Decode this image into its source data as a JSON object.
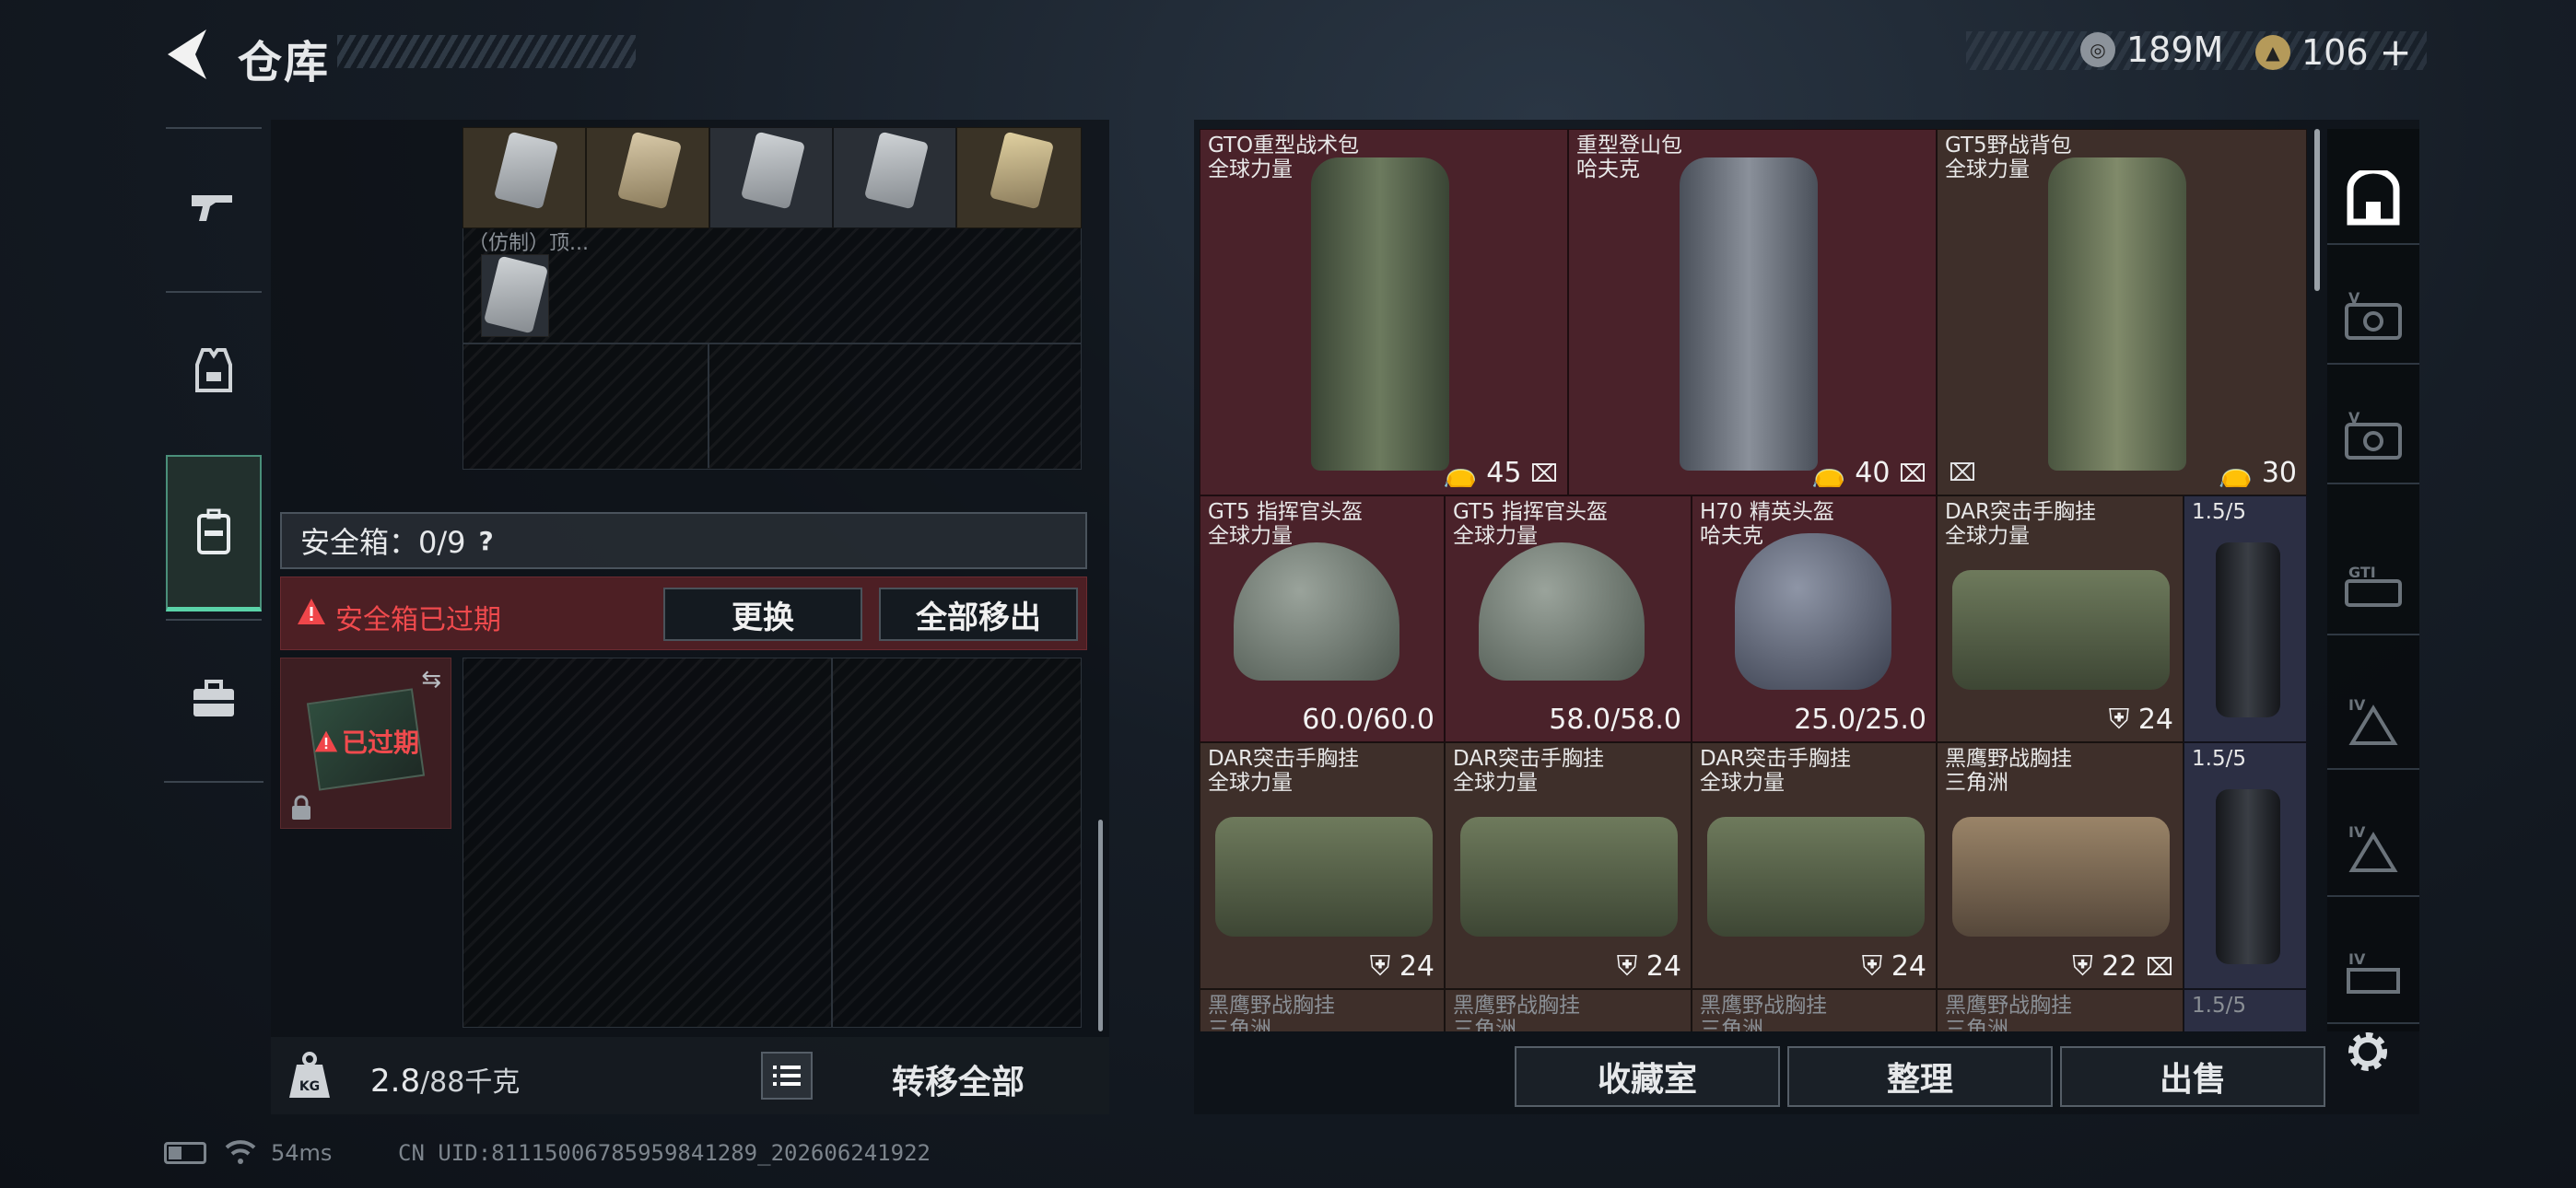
{
  "header": {
    "title": "仓库"
  },
  "currency": {
    "silver": "189M",
    "gold": "106"
  },
  "safebox": {
    "label": "安全箱：0/9",
    "help": "?",
    "expired_warning": "安全箱已过期",
    "replace": "更换",
    "move_all_out": "全部移出",
    "expired_tag": "已过期"
  },
  "grid_label": "（仿制）顶...",
  "weight": {
    "current": "2.8",
    "max": "/88千克"
  },
  "transfer_all": "转移全部",
  "items": [
    {
      "line1": "GTO重型战术包",
      "line2": "全球力量",
      "value": "45"
    },
    {
      "line1": "重型登山包",
      "line2": "哈夫克",
      "value": "40"
    },
    {
      "line1": "GT5野战背包",
      "line2": "全球力量",
      "value": "30"
    },
    {
      "line1": "GT5 指挥官头盔",
      "line2": "全球力量",
      "value": "60.0/60.0"
    },
    {
      "line1": "GT5 指挥官头盔",
      "line2": "全球力量",
      "value": "58.0/58.0"
    },
    {
      "line1": "H70 精英头盔",
      "line2": "哈夫克",
      "value": "25.0/25.0"
    },
    {
      "line1": "DAR突击手胸挂",
      "line2": "全球力量",
      "value": "24"
    },
    {
      "line1": "1.5/5",
      "line2": "",
      "value": ""
    },
    {
      "line1": "DAR突击手胸挂",
      "line2": "全球力量",
      "value": "24"
    },
    {
      "line1": "DAR突击手胸挂",
      "line2": "全球力量",
      "value": "24"
    },
    {
      "line1": "DAR突击手胸挂",
      "line2": "全球力量",
      "value": "24"
    },
    {
      "line1": "黑鹰野战胸挂",
      "line2": "三角洲",
      "value": "22"
    },
    {
      "line1": "1.5/5",
      "line2": "",
      "value": ""
    },
    {
      "line1": "黑鹰野战胸挂",
      "line2": "三角洲",
      "value": ""
    },
    {
      "line1": "黑鹰野战胸挂",
      "line2": "三角洲",
      "value": ""
    },
    {
      "line1": "黑鹰野战胸挂",
      "line2": "三角洲",
      "value": ""
    },
    {
      "line1": "黑鹰野战胸挂",
      "line2": "三角洲",
      "value": ""
    },
    {
      "line1": "1.5/5",
      "line2": "",
      "value": ""
    }
  ],
  "right_icon_labels": [
    "V",
    "V",
    "GTI",
    "IV",
    "IV",
    "IV"
  ],
  "actions": {
    "collection": "收藏室",
    "organize": "整理",
    "sell": "出售"
  },
  "status": {
    "ping": "54ms",
    "uid": "CN UID:81115006785959841289_202606241922"
  }
}
